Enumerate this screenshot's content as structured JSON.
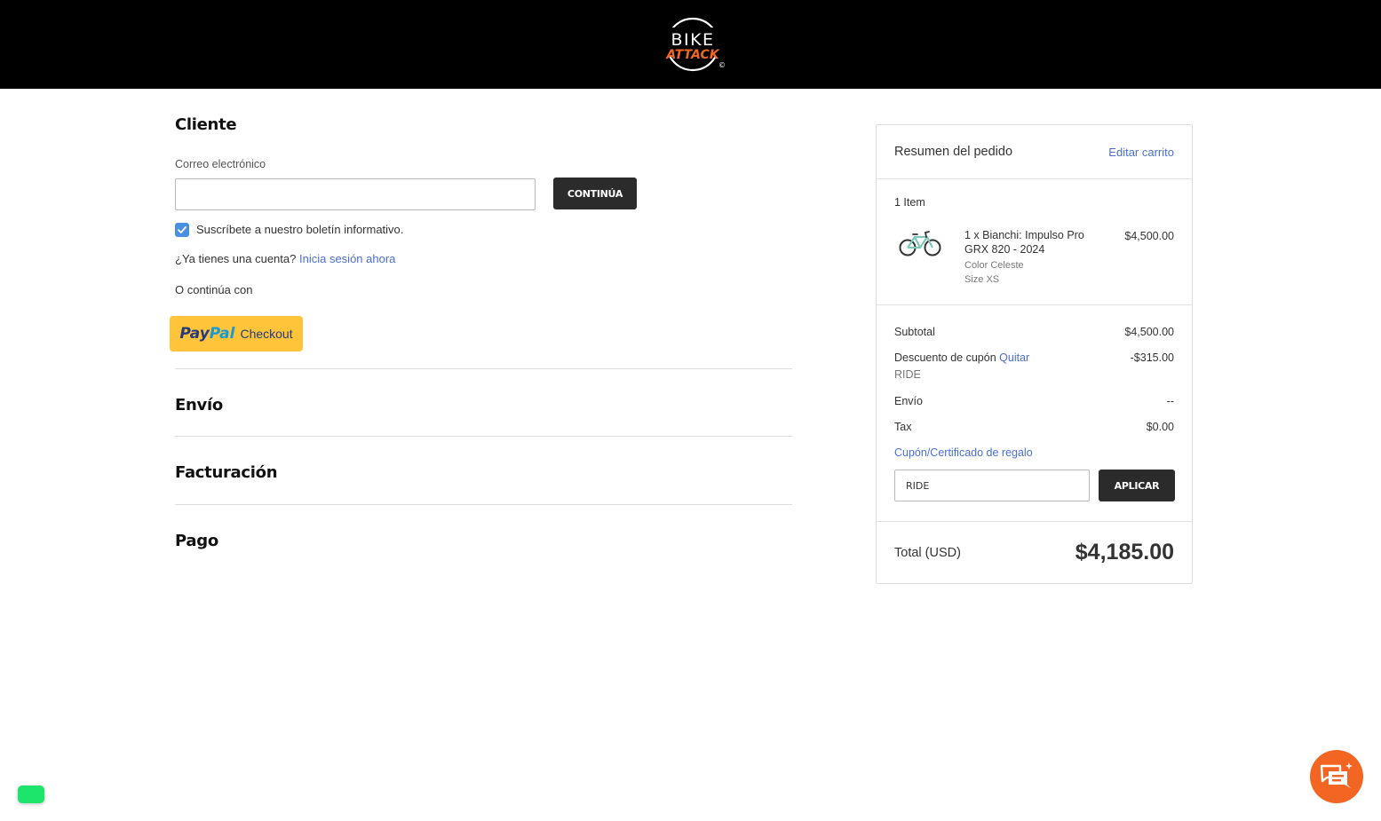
{
  "header": {
    "logo_top": "BIKE",
    "logo_bottom": "ATTACK",
    "logo_mark": "©"
  },
  "customer": {
    "title": "Cliente",
    "email_label": "Correo electrónico",
    "email_value": "",
    "continue_button": "CONTINÚA",
    "newsletter_label": "Suscríbete a nuestro boletín informativo.",
    "newsletter_checked": true,
    "account_question": "¿Ya tienes una cuenta?",
    "signin_link": "Inicia sesión ahora",
    "continue_with": "O continúa con",
    "paypal_pay": "Pay",
    "paypal_pal": "Pal",
    "paypal_checkout": "Checkout"
  },
  "steps": {
    "shipping": "Envío",
    "billing": "Facturación",
    "payment": "Pago"
  },
  "summary": {
    "title": "Resumen del pedido",
    "edit_link": "Editar carrito",
    "items_count": "1 Item",
    "product": {
      "name": "1 x Bianchi: Impulso Pro GRX 820 - 2024",
      "color": "Color Celeste",
      "size": "Size XS",
      "price": "$4,500.00"
    },
    "subtotal_label": "Subtotal",
    "subtotal_value": "$4,500.00",
    "discount_label": "Descuento de cupón",
    "discount_remove": "Quitar",
    "discount_value": "-$315.00",
    "coupon_code": "RIDE",
    "shipping_label": "Envío",
    "shipping_value": "--",
    "tax_label": "Tax",
    "tax_value": "$0.00",
    "coupon_link": "Cupón/Certificado de regalo",
    "coupon_input_value": "RIDE",
    "apply_button": "APLICAR",
    "total_label": "Total (USD)",
    "total_value": "$4,185.00"
  },
  "colors": {
    "header_bg": "#000000",
    "logo_accent": "#f26522",
    "link": "#4a6fd0",
    "dark_button": "#2b2b2b",
    "paypal_yellow": "#ffc439",
    "chat_orange": "#f26522",
    "green_widget": "#1de46a"
  },
  "icons": {
    "checkbox": "check-icon",
    "product": "bicycle-icon",
    "chat": "chat-sparkle-icon"
  }
}
